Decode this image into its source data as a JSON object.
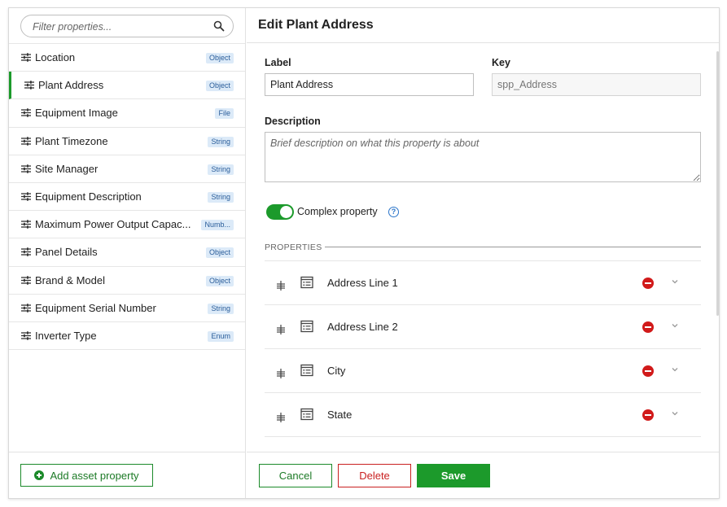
{
  "filter": {
    "placeholder": "Filter properties..."
  },
  "sidebar": {
    "items": [
      {
        "label": "Location",
        "type": "Object"
      },
      {
        "label": "Plant Address",
        "type": "Object",
        "active": true
      },
      {
        "label": "Equipment Image",
        "type": "File"
      },
      {
        "label": "Plant Timezone",
        "type": "String"
      },
      {
        "label": "Site Manager",
        "type": "String"
      },
      {
        "label": "Equipment Description",
        "type": "String"
      },
      {
        "label": "Maximum Power Output Capac...",
        "type": "Numb..."
      },
      {
        "label": "Panel Details",
        "type": "Object"
      },
      {
        "label": "Brand & Model",
        "type": "Object"
      },
      {
        "label": "Equipment Serial Number",
        "type": "String"
      },
      {
        "label": "Inverter Type",
        "type": "Enum"
      }
    ],
    "add_label": "Add asset property"
  },
  "editor": {
    "title": "Edit Plant Address",
    "label_caption": "Label",
    "label_value": "Plant Address",
    "key_caption": "Key",
    "key_placeholder": "spp_Address",
    "description_caption": "Description",
    "description_placeholder": "Brief description on what this property is about",
    "complex_label": "Complex property",
    "complex_enabled": true,
    "help_glyph": "?",
    "properties_title": "PROPERTIES",
    "properties": [
      {
        "label": "Address Line 1"
      },
      {
        "label": "Address Line 2"
      },
      {
        "label": "City"
      },
      {
        "label": "State"
      }
    ]
  },
  "footer": {
    "cancel_label": "Cancel",
    "delete_label": "Delete",
    "save_label": "Save"
  },
  "colors": {
    "accent_green": "#1c9a2b",
    "danger_red": "#c92020",
    "badge_bg": "#dceaf8",
    "badge_text": "#2a5d9a",
    "help_blue": "#2a74c9"
  },
  "icons": {
    "search": "search-icon",
    "sidebar_item": "sliders-icon",
    "add": "plus-circle-icon",
    "drag": "drag-handle-icon",
    "field": "table-field-icon",
    "remove": "minus-circle-icon",
    "expand": "chevron-down-icon",
    "help": "question-circle-icon"
  }
}
